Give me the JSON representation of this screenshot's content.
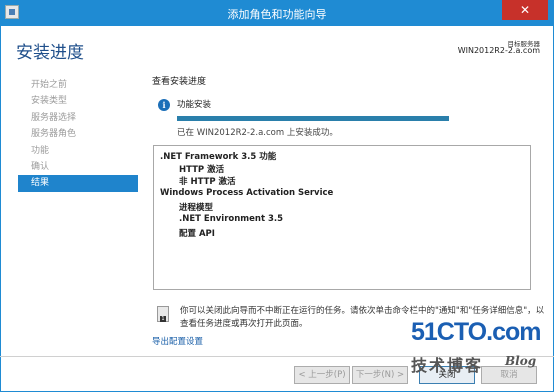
{
  "window": {
    "title": "添加角色和功能向导",
    "close_label": "✕"
  },
  "header": {
    "page_title": "安装进度",
    "server_label": "目标服务器",
    "server_name": "WIN2012R2-2.a.com"
  },
  "nav": {
    "items": [
      {
        "label": "开始之前"
      },
      {
        "label": "安装类型"
      },
      {
        "label": "服务器选择"
      },
      {
        "label": "服务器角色"
      },
      {
        "label": "功能"
      },
      {
        "label": "确认"
      },
      {
        "label": "结果"
      }
    ]
  },
  "main": {
    "section_title": "查看安装进度",
    "info_icon": "i",
    "install_label": "功能安装",
    "progress_fraction": 1.0,
    "status_text": "已在 WIN2012R2-2.a.com 上安装成功。",
    "results": [
      {
        "text": ".NET Framework 3.5 功能",
        "level": 0
      },
      {
        "text": "HTTP 激活",
        "level": 1
      },
      {
        "text": "非 HTTP 激活",
        "level": 1
      },
      {
        "text": "Windows Process Activation Service",
        "level": 0
      },
      {
        "text": "进程模型",
        "level": 1
      },
      {
        "text": ".NET Environment 3.5",
        "level": 1
      },
      {
        "text": "配置 API",
        "level": 1
      }
    ],
    "note_text": "你可以关闭此向导而不中断正在运行的任务。请依次单击命令栏中的\"通知\"和\"任务详细信息\"，以查看任务进度或再次打开此页面。",
    "export_link": "导出配置设置"
  },
  "footer": {
    "prev_label": "< 上一步(P)",
    "next_label": "下一步(N) >",
    "close_label": "关闭",
    "cancel_label": "取消"
  },
  "watermark": {
    "site": "51CTO.com",
    "tagline": "技术博客",
    "blog": "Blog"
  },
  "colors": {
    "accent": "#1f8bd3",
    "selected_nav": "#1f84cc",
    "progress": "#2a7fab",
    "close": "#c7312a"
  }
}
